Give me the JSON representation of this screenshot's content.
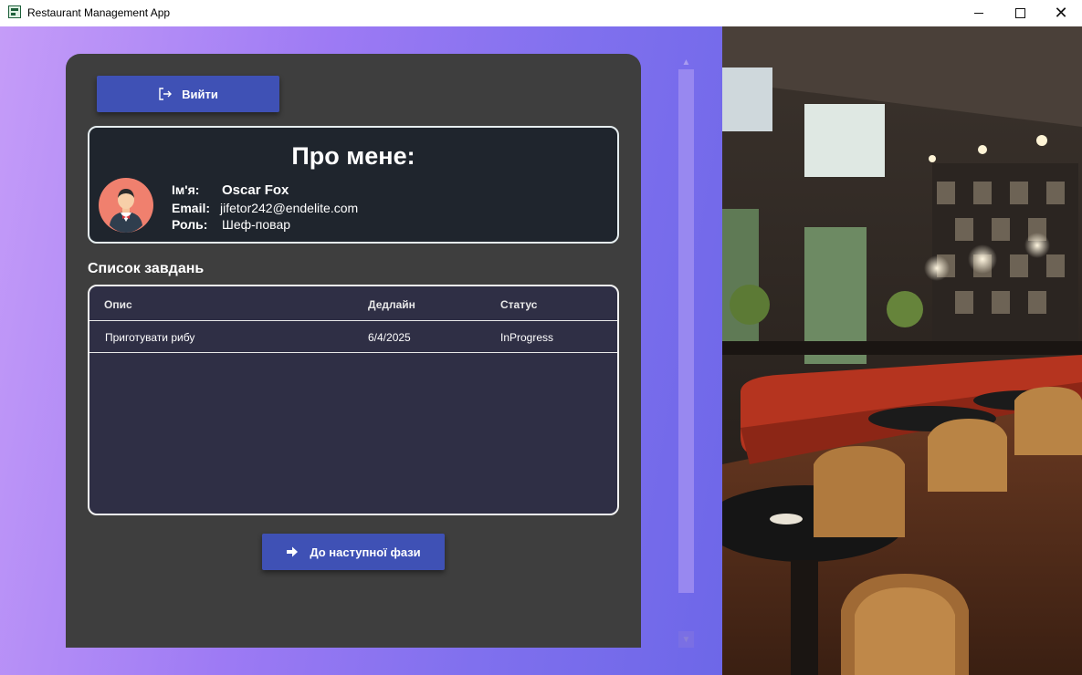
{
  "window": {
    "title": "Restaurant Management App",
    "minimize": "",
    "maximize": "",
    "close": "✕"
  },
  "header": {
    "logout_label": "Вийти"
  },
  "profile": {
    "title": "Про мене:",
    "name_label": "Ім'я:",
    "name_value": "Oscar Fox",
    "email_label": "Email:",
    "email_value": "jifetor242@endelite.com",
    "role_label": "Роль:",
    "role_value": "Шеф-повар"
  },
  "tasks": {
    "title": "Список завдань",
    "columns": [
      "Опис",
      "Дедлайн",
      "Статус"
    ],
    "rows": [
      [
        "Приготувати рибу",
        "6/4/2025",
        "InProgress"
      ]
    ]
  },
  "footer": {
    "next_label": "До наступної фази"
  },
  "icons": {
    "app": "app-icon",
    "logout": "logout-icon",
    "next": "arrow-right-icon",
    "scroll_up": "chevron-up-icon",
    "scroll_down": "chevron-down-icon",
    "avatar": "chef-avatar"
  },
  "colors": {
    "accent": "#3f51b5",
    "card": "#3e3e3e",
    "profile_bg": "#1f252d",
    "table_bg": "#2f2f45"
  }
}
